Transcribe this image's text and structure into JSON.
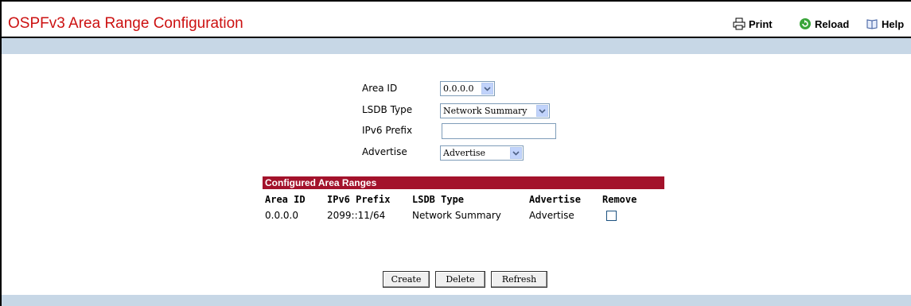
{
  "header": {
    "title": "OSPFv3 Area Range Configuration",
    "print_label": "Print",
    "reload_label": "Reload",
    "help_label": "Help"
  },
  "form": {
    "area_id": {
      "label": "Area ID",
      "value": "0.0.0.0"
    },
    "lsdb_type": {
      "label": "LSDB Type",
      "value": "Network Summary"
    },
    "ipv6_prefix": {
      "label": "IPv6 Prefix",
      "value": ""
    },
    "advertise": {
      "label": "Advertise",
      "value": "Advertise"
    }
  },
  "table": {
    "title": "Configured Area Ranges",
    "columns": [
      "Area ID",
      "IPv6 Prefix",
      "LSDB Type",
      "Advertise",
      "Remove"
    ],
    "rows": [
      {
        "area_id": "0.0.0.0",
        "ipv6_prefix": "2099::11/64",
        "lsdb_type": "Network Summary",
        "advertise": "Advertise",
        "remove": false
      }
    ]
  },
  "buttons": {
    "create": "Create",
    "delete": "Delete",
    "refresh": "Refresh"
  },
  "colors": {
    "title": "#cc1111",
    "band": "#c7d7e6",
    "table_header": "#a3122b"
  }
}
